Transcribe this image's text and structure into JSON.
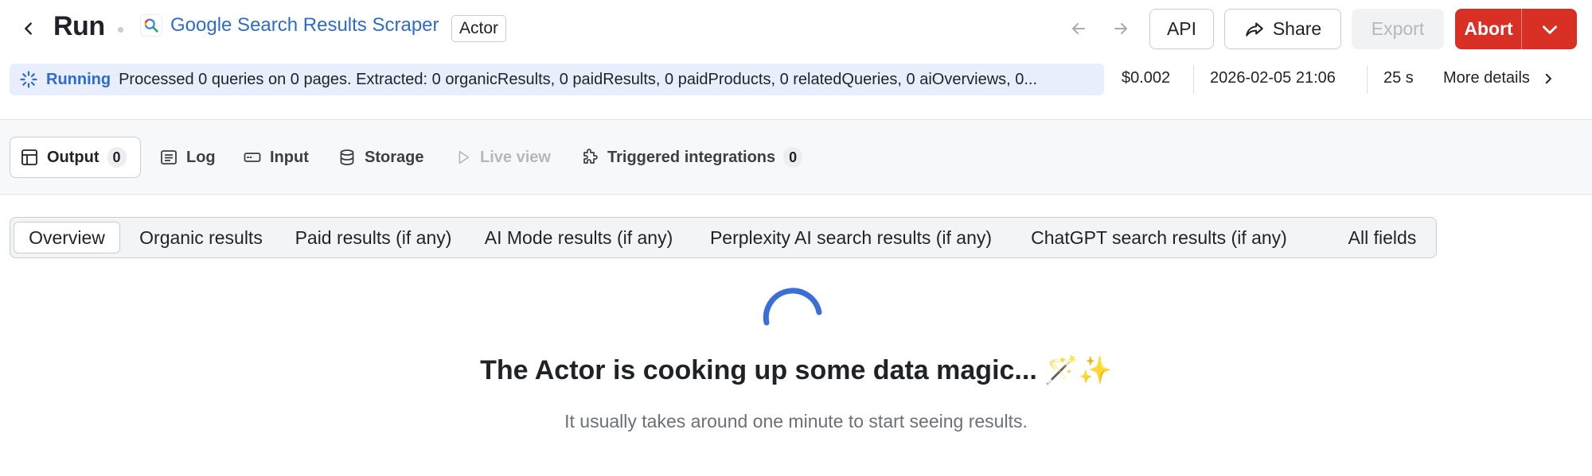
{
  "header": {
    "title": "Run",
    "actor_name": "Google Search Results Scraper",
    "actor_badge": "Actor",
    "buttons": {
      "api": "API",
      "share": "Share",
      "export": "Export",
      "abort": "Abort"
    }
  },
  "status": {
    "state": "Running",
    "message": "Processed 0 queries on 0 pages. Extracted: 0 organicResults, 0 paidResults, 0 paidProducts, 0 relatedQueries, 0 aiOverviews, 0...",
    "cost": "$0.002",
    "started": "2026-02-05 21:06",
    "duration": "25 s",
    "more_details": "More details"
  },
  "tabs": [
    {
      "label": "Output",
      "count": "0",
      "icon": "table-icon"
    },
    {
      "label": "Log",
      "icon": "log-icon"
    },
    {
      "label": "Input",
      "icon": "input-icon"
    },
    {
      "label": "Storage",
      "icon": "database-icon"
    },
    {
      "label": "Live view",
      "icon": "play-icon"
    },
    {
      "label": "Triggered integrations",
      "count": "0",
      "icon": "puzzle-icon"
    }
  ],
  "views": [
    "Overview",
    "Organic results",
    "Paid results (if any)",
    "AI Mode results (if any)",
    "Perplexity AI search results (if any)",
    "ChatGPT search results (if any)",
    "All fields"
  ],
  "empty_state": {
    "title": "The Actor is cooking up some data magic... 🪄✨",
    "subtitle": "It usually takes around one minute to start seeing results."
  },
  "colors": {
    "link": "#2e6bd1",
    "abort": "#d93025",
    "status_bg": "#e8eefc"
  }
}
